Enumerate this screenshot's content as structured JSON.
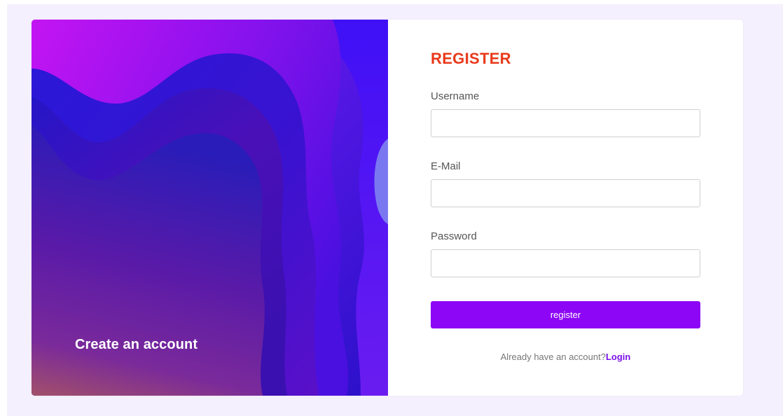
{
  "art_panel": {
    "caption": "Create an account",
    "image": "purple-wave-abstract-illustration"
  },
  "form": {
    "title": "REGISTER",
    "fields": [
      {
        "label": "Username",
        "value": "",
        "placeholder": ""
      },
      {
        "label": "E-Mail",
        "value": "",
        "placeholder": ""
      },
      {
        "label": "Password",
        "value": "",
        "placeholder": ""
      }
    ],
    "submit_label": "register",
    "login_prompt": "Already have an account?",
    "login_link_label": "Login"
  },
  "colors": {
    "page_background": "#f5f0fd",
    "card_background": "#ffffff",
    "title": "#e8391a",
    "button": "#8d07f6",
    "link": "#7b12e8"
  }
}
